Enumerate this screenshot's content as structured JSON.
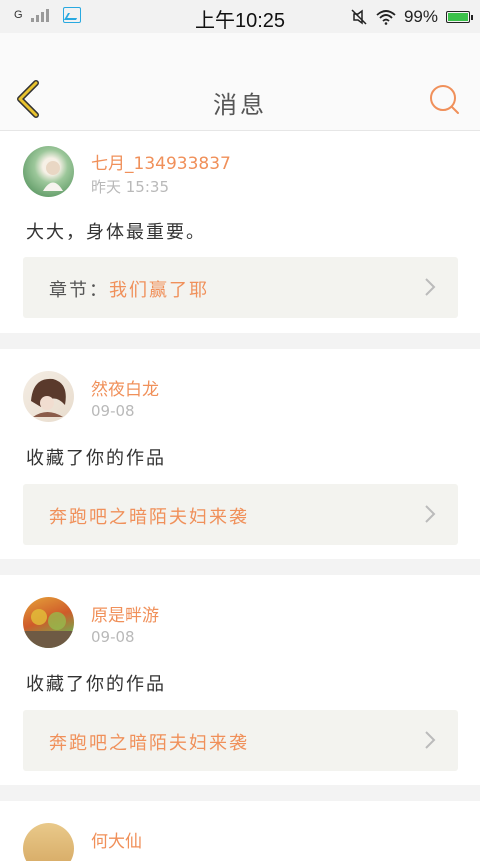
{
  "status_bar": {
    "network": "G",
    "time": "上午10:25",
    "battery": "99%"
  },
  "header": {
    "title": "消息",
    "back_icon": "chevron-left-icon",
    "search_icon": "search-icon"
  },
  "colors": {
    "accent": "#f0905a",
    "back_arrow": "#e8c22e",
    "muted": "#b9b9b9",
    "ref_bg": "#f3f3ef"
  },
  "messages": [
    {
      "user": "七月_134933837",
      "time": "昨天 15:35",
      "content": "大大，身体最重要。",
      "ref_prefix": "章节：",
      "ref_title": "我们赢了耶"
    },
    {
      "user": "然夜白龙",
      "time": "09-08",
      "content": "收藏了你的作品",
      "ref_prefix": "",
      "ref_title": "奔跑吧之暗陌夫妇来袭"
    },
    {
      "user": "原是畔游",
      "time": "09-08",
      "content": "收藏了你的作品",
      "ref_prefix": "",
      "ref_title": "奔跑吧之暗陌夫妇来袭"
    },
    {
      "user": "何大仙",
      "time": "",
      "content": "",
      "ref_prefix": "",
      "ref_title": ""
    }
  ]
}
